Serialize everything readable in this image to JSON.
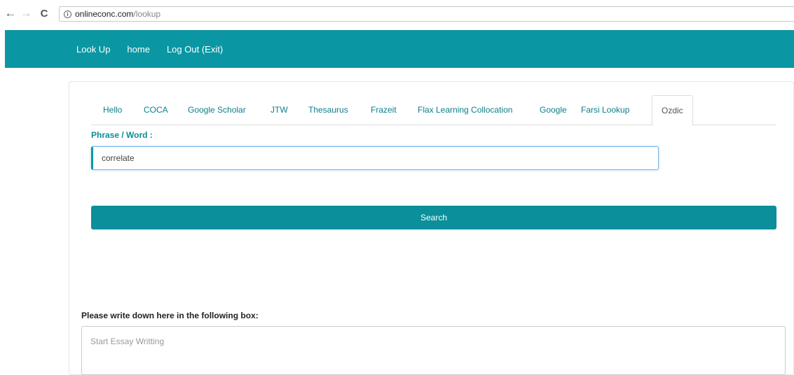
{
  "browser": {
    "url_host": "onlineconc.com",
    "url_path": "/lookup",
    "info_glyph": "i"
  },
  "nav": {
    "items": [
      "Look Up",
      "home",
      "Log Out (Exit)"
    ]
  },
  "tabs": [
    {
      "label": "Hello"
    },
    {
      "label": "COCA"
    },
    {
      "label": "Google Scholar"
    },
    {
      "label": "JTW"
    },
    {
      "label": "Thesaurus"
    },
    {
      "label": "Frazeit"
    },
    {
      "label": "Flax Learning Collocation"
    },
    {
      "label": "Google"
    },
    {
      "label": "Farsi Lookup"
    },
    {
      "label": "Ozdic",
      "active": true
    }
  ],
  "form": {
    "field_label": "Phrase / Word :",
    "field_value": "correlate",
    "search_label": "Search"
  },
  "essay": {
    "label": "Please write down here in the following box:",
    "placeholder": "Start Essay Writting"
  },
  "colors": {
    "brand": "#0a97a3",
    "button": "#0a8f9b"
  }
}
